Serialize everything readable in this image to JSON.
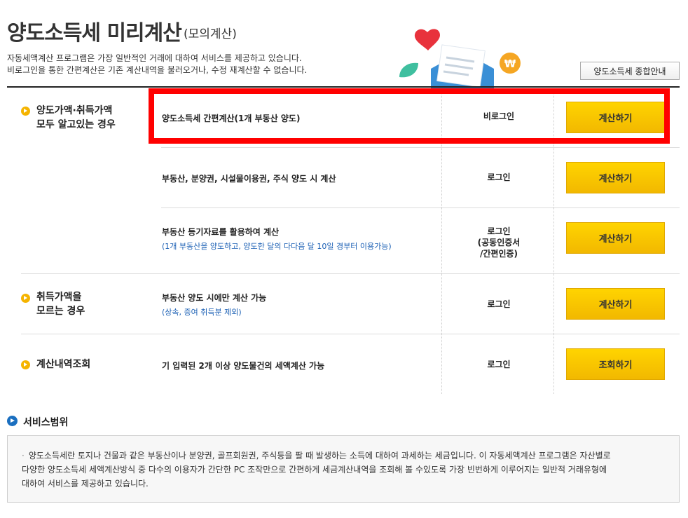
{
  "header": {
    "title": "양도소득세 미리계산",
    "subtitle": "(모의계산)",
    "desc_line1": "자동세액계산 프로그램은 가장 일반적인 거래에 대하여 서비스를 제공하고 있습니다.",
    "desc_line2": "비로그인을 통한 간편계산은 기존 계산내역을 불러오거나, 수정 재계산할 수 없습니다.",
    "guide_button": "양도소득세 종합안내"
  },
  "sections": {
    "known_label_line1": "양도가액·취득가액",
    "known_label_line2": "모두 알고있는 경우",
    "unknown_label_line1": "취득가액을",
    "unknown_label_line2": "모르는 경우",
    "history_label": "계산내역조회"
  },
  "rows": [
    {
      "text": "양도소득세 간편계산(1개 부동산 양도)",
      "sub": "",
      "login": "비로그인",
      "button": "계산하기"
    },
    {
      "text": "부동산, 분양권, 시설물이용권, 주식 양도 시 계산",
      "sub": "",
      "login": "로그인",
      "button": "계산하기"
    },
    {
      "text": "부동산 등기자료를 활용하여 계산",
      "sub": "(1개 부동산을 양도하고, 양도한 달의 다다음 달 10일 경부터 이용가능)",
      "login_line1": "로그인",
      "login_line2": "(공동인증서",
      "login_line3": "/간편인증)",
      "button": "계산하기"
    },
    {
      "text": "부동산 양도 시에만 계산 가능",
      "sub": "(상속, 증여 취득분 제외)",
      "login": "로그인",
      "button": "계산하기"
    },
    {
      "text": "기 입력된 2개 이상 양도물건의 세액계산 가능",
      "sub": "",
      "login": "로그인",
      "button": "조회하기"
    }
  ],
  "service": {
    "title": "서비스범위",
    "line1": "양도소득세란 토지나 건물과 같은 부동산이나 분양권, 골프회원권, 주식등을 팔 때 발생하는 소득에 대하여 과세하는 세금입니다. 이 자동세액계산 프로그램은 자산별로",
    "line2": "다양한 양도소득세 세액계산방식 중 다수의 이용자가 간단한 PC 조작만으로 간편하게 세금계산내역을 조회해 볼 수있도록 가장 빈번하게 이루어지는 일반적 거래유형에",
    "line3": "대하여 서비스를 제공하고 있습니다."
  },
  "colors": {
    "accent_yellow": "#f5b400",
    "button_yellow": "#ffd400",
    "highlight_red": "#ff0000",
    "link_blue": "#1a5fb4"
  },
  "icons": {
    "bullet": "arrow-circle-icon",
    "service": "arrow-circle-blue-icon"
  }
}
